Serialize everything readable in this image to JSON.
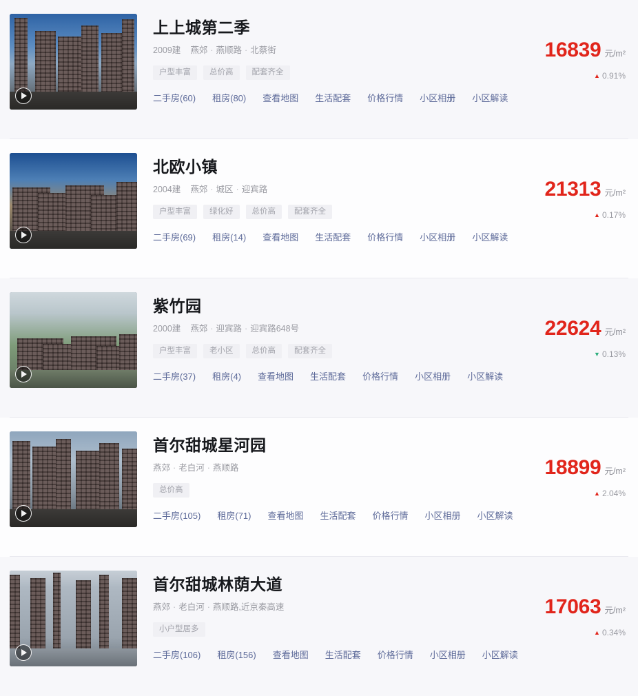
{
  "page": {
    "background_color": "#fbfbfd",
    "accent_price_color": "#e1251b",
    "link_color": "#5d6a99",
    "tag_bg_color": "#f0f0f4",
    "up_arrow_color": "#e1251b",
    "down_arrow_color": "#2fae7e"
  },
  "common": {
    "price_unit": "元/m²",
    "built_suffix": "建",
    "play_icon": "play-icon",
    "arrow_up": "▲",
    "arrow_down": "▼",
    "dot_sep": "·"
  },
  "listings": [
    {
      "name": "上上城第二季",
      "built_year": "2009建",
      "district": "燕郊",
      "area": "燕顺路",
      "street": "北蔡街",
      "tags": [
        "户型丰富",
        "总价高",
        "配套齐全"
      ],
      "price": "16839",
      "price_unit": "元/m²",
      "change_value": "0.91%",
      "change_direction": "up",
      "change_arrow": "▲",
      "links": [
        "二手房(60)",
        "租房(80)",
        "查看地图",
        "生活配套",
        "价格行情",
        "小区相册",
        "小区解读"
      ]
    },
    {
      "name": "北欧小镇",
      "built_year": "2004建",
      "district": "燕郊",
      "area": "城区",
      "street": "迎宾路",
      "tags": [
        "户型丰富",
        "绿化好",
        "总价高",
        "配套齐全"
      ],
      "price": "21313",
      "price_unit": "元/m²",
      "change_value": "0.17%",
      "change_direction": "up",
      "change_arrow": "▲",
      "links": [
        "二手房(69)",
        "租房(14)",
        "查看地图",
        "生活配套",
        "价格行情",
        "小区相册",
        "小区解读"
      ]
    },
    {
      "name": "紫竹园",
      "built_year": "2000建",
      "district": "燕郊",
      "area": "迎宾路",
      "street": "迎宾路648号",
      "tags": [
        "户型丰富",
        "老小区",
        "总价高",
        "配套齐全"
      ],
      "price": "22624",
      "price_unit": "元/m²",
      "change_value": "0.13%",
      "change_direction": "down",
      "change_arrow": "▼",
      "links": [
        "二手房(37)",
        "租房(4)",
        "查看地图",
        "生活配套",
        "价格行情",
        "小区相册",
        "小区解读"
      ]
    },
    {
      "name": "首尔甜城星河园",
      "built_year": "",
      "district": "燕郊",
      "area": "老白河",
      "street": "燕顺路",
      "tags": [
        "总价高"
      ],
      "price": "18899",
      "price_unit": "元/m²",
      "change_value": "2.04%",
      "change_direction": "up",
      "change_arrow": "▲",
      "links": [
        "二手房(105)",
        "租房(71)",
        "查看地图",
        "生活配套",
        "价格行情",
        "小区相册",
        "小区解读"
      ]
    },
    {
      "name": "首尔甜城林荫大道",
      "built_year": "",
      "district": "燕郊",
      "area": "老白河",
      "street": "燕顺路,近京秦高速",
      "tags": [
        "小户型居多"
      ],
      "price": "17063",
      "price_unit": "元/m²",
      "change_value": "0.34%",
      "change_direction": "up",
      "change_arrow": "▲",
      "links": [
        "二手房(106)",
        "租房(156)",
        "查看地图",
        "生活配套",
        "价格行情",
        "小区相册",
        "小区解读"
      ]
    }
  ]
}
